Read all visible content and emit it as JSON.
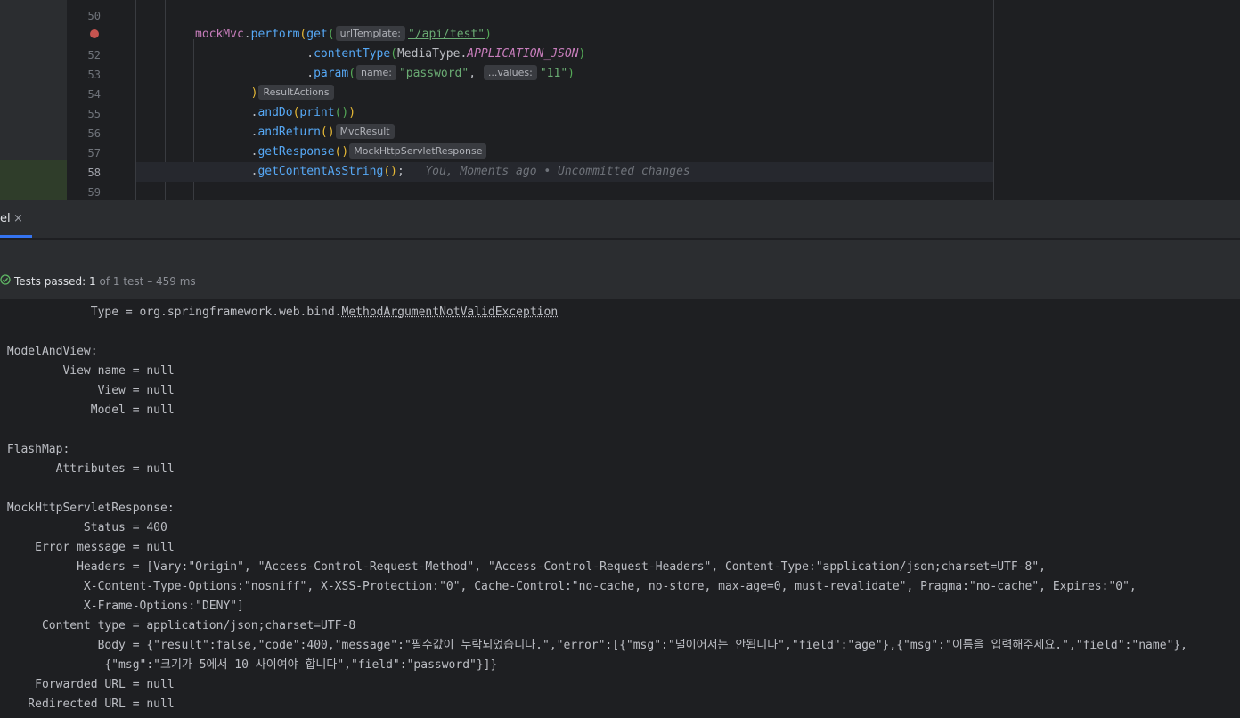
{
  "editor": {
    "line_numbers": [
      "50",
      "",
      "52",
      "53",
      "54",
      "55",
      "56",
      "57",
      "58",
      "59"
    ],
    "hints": {
      "url_template": "urlTemplate:",
      "name": "name:",
      "values": "...values:",
      "result_actions": "ResultActions",
      "mvc_result": "MvcResult",
      "mock_response": "MockHttpServletResponse"
    },
    "code": {
      "mockmvc": "mockMvc",
      "perform": "perform",
      "get": "get",
      "url": "\"/api/test\"",
      "content_type": "contentType",
      "media_type": "MediaType",
      "app_json": "APPLICATION_JSON",
      "param": "param",
      "password_str": "\"password\"",
      "eleven_str": "\"11\"",
      "and_do": "andDo",
      "print": "print",
      "and_return": "andReturn",
      "get_response": "getResponse",
      "get_content": "getContentAsString"
    },
    "git_blame": "You, Moments ago • Uncommitted changes"
  },
  "tool_window": {
    "tab_label": "el",
    "close_symbol": "×"
  },
  "status": {
    "passed_label": "Tests passed:",
    "passed_count": "1",
    "of_text": "of 1 test – 459 ms",
    "state_color": "#5fb865"
  },
  "console": {
    "type_prefix": "             Type = org.springframework.web.bind.",
    "type_link": "MethodArgumentNotValidException",
    "lines": [
      "",
      " ModelAndView:",
      "         View name = null",
      "              View = null",
      "             Model = null",
      "",
      " FlashMap:",
      "        Attributes = null",
      "",
      " MockHttpServletResponse:",
      "            Status = 400",
      "     Error message = null",
      "           Headers = [Vary:\"Origin\", \"Access-Control-Request-Method\", \"Access-Control-Request-Headers\", Content-Type:\"application/json;charset=UTF-8\",",
      "            X-Content-Type-Options:\"nosniff\", X-XSS-Protection:\"0\", Cache-Control:\"no-cache, no-store, max-age=0, must-revalidate\", Pragma:\"no-cache\", Expires:\"0\",",
      "            X-Frame-Options:\"DENY\"]",
      "      Content type = application/json;charset=UTF-8",
      "              Body = {\"result\":false,\"code\":400,\"message\":\"필수값이 누락되었습니다.\",\"error\":[{\"msg\":\"널이어서는 안됩니다\",\"field\":\"age\"},{\"msg\":\"이름을 입력해주세요.\",\"field\":\"name\"},",
      "               {\"msg\":\"크기가 5에서 10 사이여야 합니다\",\"field\":\"password\"}]}",
      "     Forwarded URL = null",
      "    Redirected URL = null"
    ]
  }
}
